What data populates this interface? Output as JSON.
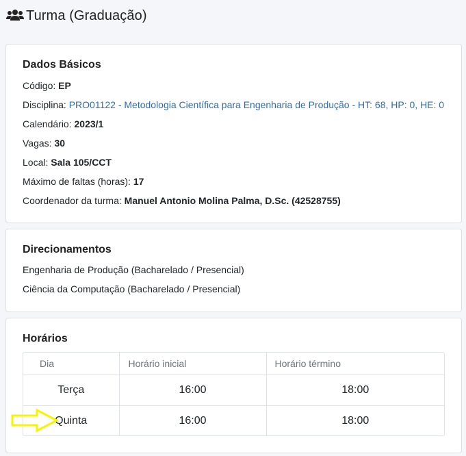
{
  "header": {
    "title": "Turma (Graduação)",
    "icon": "users-icon"
  },
  "basics": {
    "title": "Dados Básicos",
    "codigo_label": "Código:",
    "codigo_value": "EP",
    "disciplina_label": "Disciplina:",
    "disciplina_value": "PRO01122 - Metodologia Científica para Engenharia de Produção - HT: 68, HP: 0, HE: 0",
    "calendario_label": "Calendário:",
    "calendario_value": "2023/1",
    "vagas_label": "Vagas:",
    "vagas_value": "30",
    "local_label": "Local:",
    "local_value": "Sala 105/CCT",
    "faltas_label": "Máximo de faltas (horas):",
    "faltas_value": "17",
    "coordenador_label": "Coordenador da turma:",
    "coordenador_value": "Manuel Antonio Molina Palma, D.Sc. (42528755)"
  },
  "direcionamentos": {
    "title": "Direcionamentos",
    "items": [
      "Engenharia de Produção (Bacharelado / Presencial)",
      "Ciência da Computação (Bacharelado / Presencial)"
    ]
  },
  "horarios": {
    "title": "Horários",
    "columns": [
      "Dia",
      "Horário inicial",
      "Horário término"
    ],
    "rows": [
      {
        "dia": "Terça",
        "inicio": "16:00",
        "termino": "18:00"
      },
      {
        "dia": "Quinta",
        "inicio": "16:00",
        "termino": "18:00"
      }
    ]
  },
  "colors": {
    "link": "#2a6db5",
    "highlight_arrow": "#f5f500",
    "background": "#f5f6fa"
  }
}
